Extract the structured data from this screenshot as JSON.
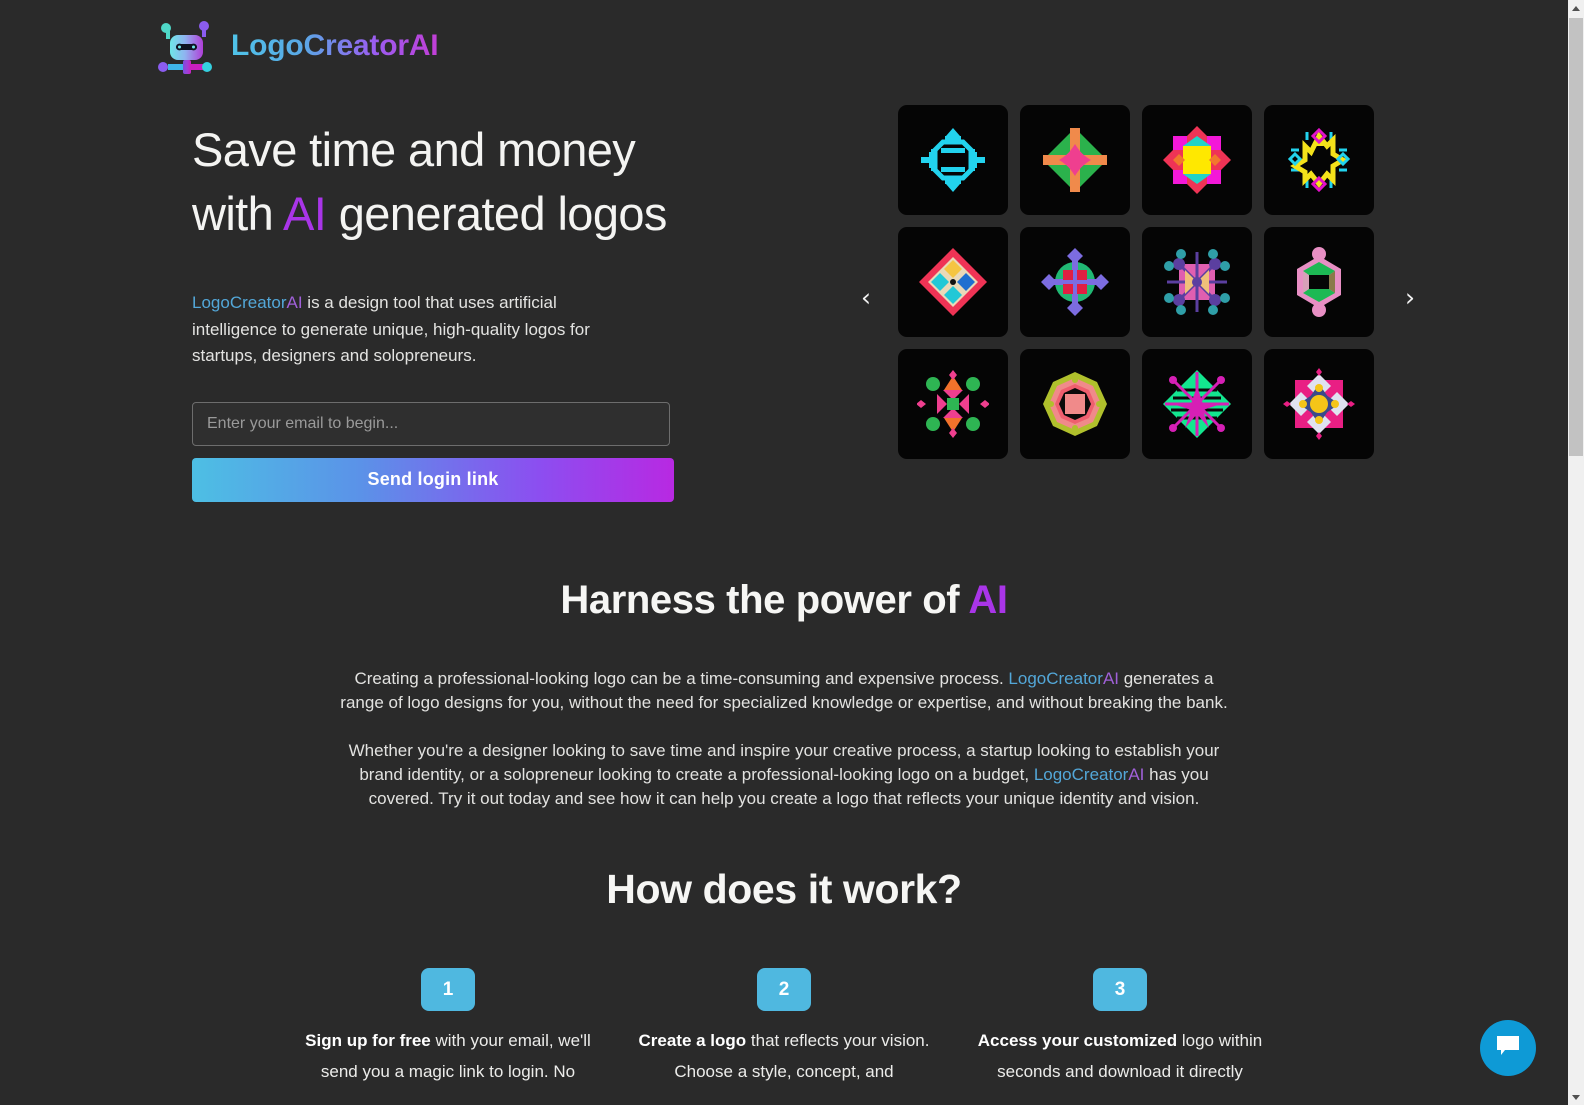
{
  "brand": {
    "name_part_1": "LogoCreator",
    "name_part_2": "AI",
    "full_name": "LogoCreatorAI",
    "icon": "robot-logo-icon",
    "gradient_start": "#4fc3e8",
    "gradient_end": "#c23fd6"
  },
  "hero": {
    "title_line_1": "Save time and money",
    "title_line_2_before": "with ",
    "title_line_2_accent": "AI",
    "title_line_2_after": " generated logos",
    "subtitle_brand_1": "LogoCreator",
    "subtitle_brand_2": "AI",
    "subtitle_rest": " is a design tool that uses artificial intelligence to generate unique, high-quality logos for startups, designers and solopreneurs.",
    "email_placeholder": "Enter your email to begin...",
    "email_value": "",
    "cta_label": "Send login link"
  },
  "carousel": {
    "prev_icon": "chevron-left-icon",
    "next_icon": "chevron-right-icon",
    "prev_glyph": "‹",
    "next_glyph": "›",
    "tiles": [
      {
        "id": 1,
        "name": "cyan-octagon-ring-logo",
        "colors": [
          "#22d3ee"
        ]
      },
      {
        "id": 2,
        "name": "green-orange-cross-diamond-logo",
        "colors": [
          "#2bb24c",
          "#f08a4b",
          "#ef3f8f"
        ]
      },
      {
        "id": 3,
        "name": "magenta-yellow-star-burst-logo",
        "colors": [
          "#f318d8",
          "#ffe800",
          "#22d3c8",
          "#ef3355"
        ]
      },
      {
        "id": 4,
        "name": "yellow-cyan-snowflake-logo",
        "colors": [
          "#f4e21a",
          "#22d3ee",
          "#e312c9"
        ]
      },
      {
        "id": 5,
        "name": "red-diamond-quadrant-logo",
        "colors": [
          "#ef3355",
          "#f5c542",
          "#1f6fd0",
          "#22c8d6",
          "#ead9b8"
        ]
      },
      {
        "id": 6,
        "name": "green-circle-purple-diamond-logo",
        "colors": [
          "#21b874",
          "#7c6ce0",
          "#e01f42"
        ]
      },
      {
        "id": 7,
        "name": "purple-teal-grid-burst-logo",
        "colors": [
          "#5b3fa0",
          "#2f9fa8",
          "#e05fb0",
          "#f0c07a"
        ]
      },
      {
        "id": 8,
        "name": "pink-green-hexagon-logo",
        "colors": [
          "#e88fc4",
          "#1db954",
          "#8a7a4a"
        ]
      },
      {
        "id": 9,
        "name": "green-pink-orange-cluster-logo",
        "colors": [
          "#2eb553",
          "#ef3f8f",
          "#f2722b"
        ]
      },
      {
        "id": 10,
        "name": "salmon-olive-octagon-logo",
        "colors": [
          "#f08a8a",
          "#b0c02c",
          "#ef5f6f"
        ]
      },
      {
        "id": 11,
        "name": "green-magenta-starburst-logo",
        "colors": [
          "#13e68f",
          "#d61fb5"
        ]
      },
      {
        "id": 12,
        "name": "pink-white-yellow-rosette-logo",
        "colors": [
          "#e91f84",
          "#dfe2f0",
          "#f5c518",
          "#3a4a8a"
        ]
      }
    ]
  },
  "power_section": {
    "heading_before": "Harness the power of ",
    "heading_accent": "AI",
    "paragraph_1_a": "Creating a professional-looking logo can be a time-consuming and expensive process. ",
    "paragraph_1_brand_1": "LogoCreator",
    "paragraph_1_brand_2": "AI",
    "paragraph_1_b": " generates a range of logo designs for you, without the need for specialized knowledge or expertise, and without breaking the bank.",
    "paragraph_2_a": "Whether you're a designer looking to save time and inspire your creative process, a startup looking to establish your brand identity, or a solopreneur looking to create a professional-looking logo on a budget, ",
    "paragraph_2_brand_1": "LogoCreator",
    "paragraph_2_brand_2": "AI",
    "paragraph_2_b": " has you covered. Try it out today and see how it can help you create a logo that reflects your unique identity and vision."
  },
  "how_section": {
    "heading": "How does it work?",
    "steps": [
      {
        "number": "1",
        "bold": "Sign up for free",
        "rest": " with your email, we'll send you a magic link to login. No"
      },
      {
        "number": "2",
        "bold": "Create a logo",
        "rest": " that reflects your vision. Choose a style, concept, and"
      },
      {
        "number": "3",
        "bold": "Access your customized",
        "rest": " logo within seconds and download it directly"
      }
    ]
  },
  "chat": {
    "icon": "chat-bubble-icon",
    "color": "#0e9ad6"
  },
  "scrollbar": {
    "up_icon": "scroll-up-arrow-icon",
    "down_icon": "scroll-down-arrow-icon",
    "thumb_name": "scrollbar-thumb"
  },
  "colors": {
    "background": "#2a2a2a",
    "tile_background": "#050505",
    "accent_purple": "#a935e8",
    "accent_blue": "#53a7d8",
    "step_badge": "#4fb8e0"
  }
}
